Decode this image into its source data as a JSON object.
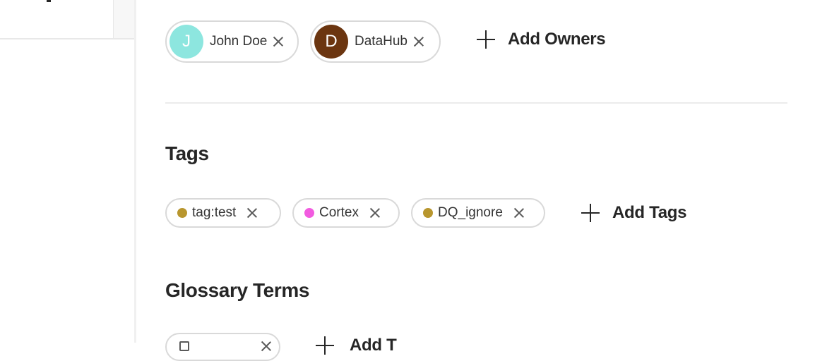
{
  "owners": {
    "items": [
      {
        "initial": "J",
        "name": "John Doe",
        "avatar_color": "#8de6df"
      },
      {
        "initial": "D",
        "name": "DataHub",
        "avatar_color": "#6b3510"
      }
    ],
    "add_label": "Add Owners"
  },
  "tags": {
    "title": "Tags",
    "items": [
      {
        "name": "tag:test",
        "color": "#b8962e"
      },
      {
        "name": "Cortex",
        "color": "#f25be0"
      },
      {
        "name": "DQ_ignore",
        "color": "#b8962e"
      }
    ],
    "add_label": "Add Tags"
  },
  "glossary_terms": {
    "title": "Glossary Terms",
    "add_label": "Add T"
  },
  "icons": {
    "remove": "close-icon",
    "add": "plus-icon",
    "term": "book-icon"
  }
}
